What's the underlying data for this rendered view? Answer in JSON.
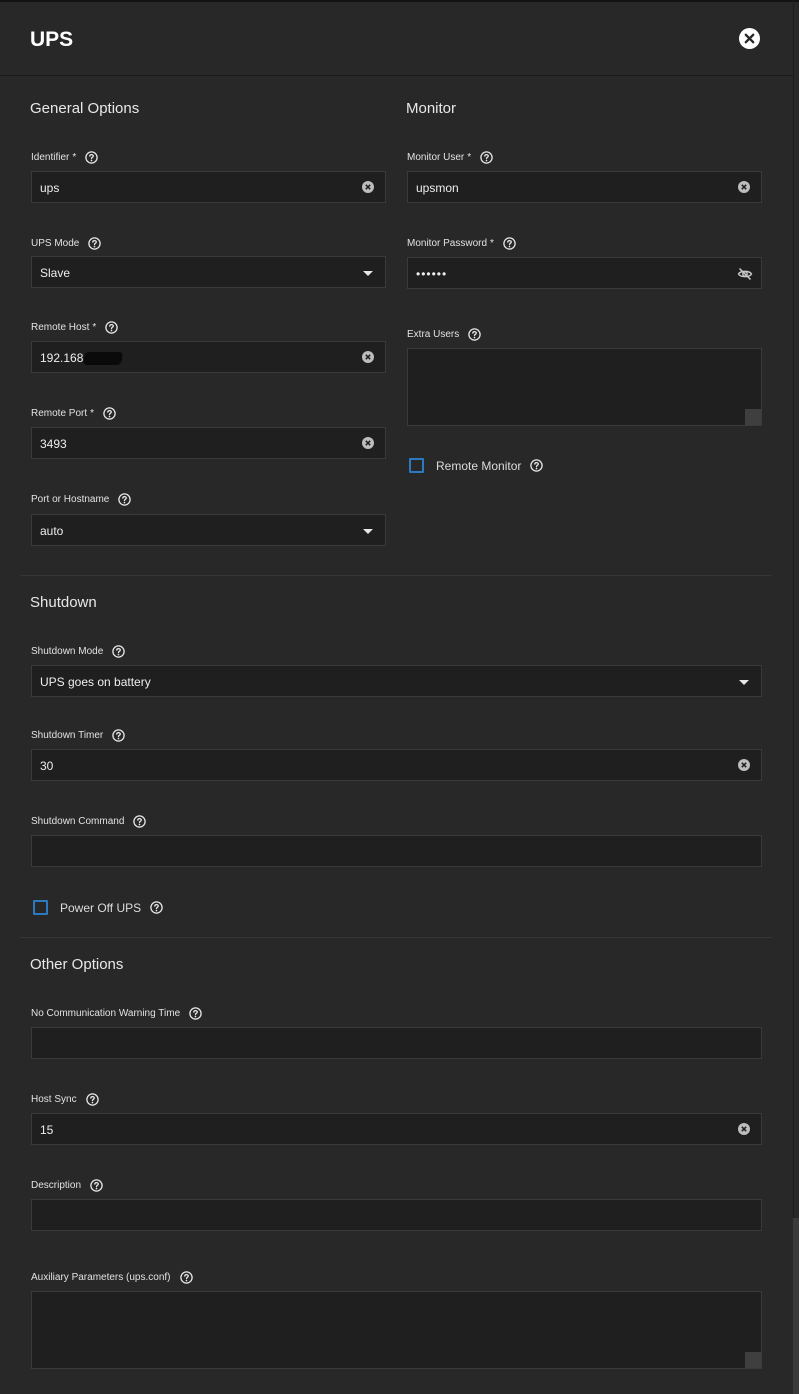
{
  "dialog": {
    "title": "UPS",
    "close_icon": "close-icon"
  },
  "colors": {
    "background": "#282828",
    "field": "#1f1f1f",
    "checkbox_border": "#2b7ac1"
  },
  "general": {
    "title": "General Options",
    "identifier": {
      "label": "Identifier",
      "required": "*",
      "value": "ups"
    },
    "ups_mode": {
      "label": "UPS Mode",
      "value": "Slave"
    },
    "remote_host": {
      "label": "Remote Host",
      "required": "*",
      "value": "192.168"
    },
    "remote_port": {
      "label": "Remote Port",
      "required": "*",
      "value": "3493"
    },
    "port_or_hostname": {
      "label": "Port or Hostname",
      "value": "auto"
    }
  },
  "monitor": {
    "title": "Monitor",
    "monitor_user": {
      "label": "Monitor User",
      "required": "*",
      "value": "upsmon"
    },
    "monitor_password": {
      "label": "Monitor Password",
      "required": "*",
      "value": "••••••"
    },
    "extra_users": {
      "label": "Extra Users",
      "value": ""
    },
    "remote_monitor": {
      "label": "Remote Monitor",
      "checked": false
    }
  },
  "shutdown": {
    "title": "Shutdown",
    "mode": {
      "label": "Shutdown Mode",
      "value": "UPS goes on battery"
    },
    "timer": {
      "label": "Shutdown Timer",
      "value": "30"
    },
    "command": {
      "label": "Shutdown Command",
      "value": ""
    },
    "power_off": {
      "label": "Power Off UPS",
      "checked": false
    }
  },
  "other": {
    "title": "Other Options",
    "no_comm_warning": {
      "label": "No Communication Warning Time",
      "value": ""
    },
    "host_sync": {
      "label": "Host Sync",
      "value": "15"
    },
    "description": {
      "label": "Description",
      "value": ""
    },
    "aux_params": {
      "label": "Auxiliary Parameters (ups.conf)",
      "value": ""
    }
  }
}
